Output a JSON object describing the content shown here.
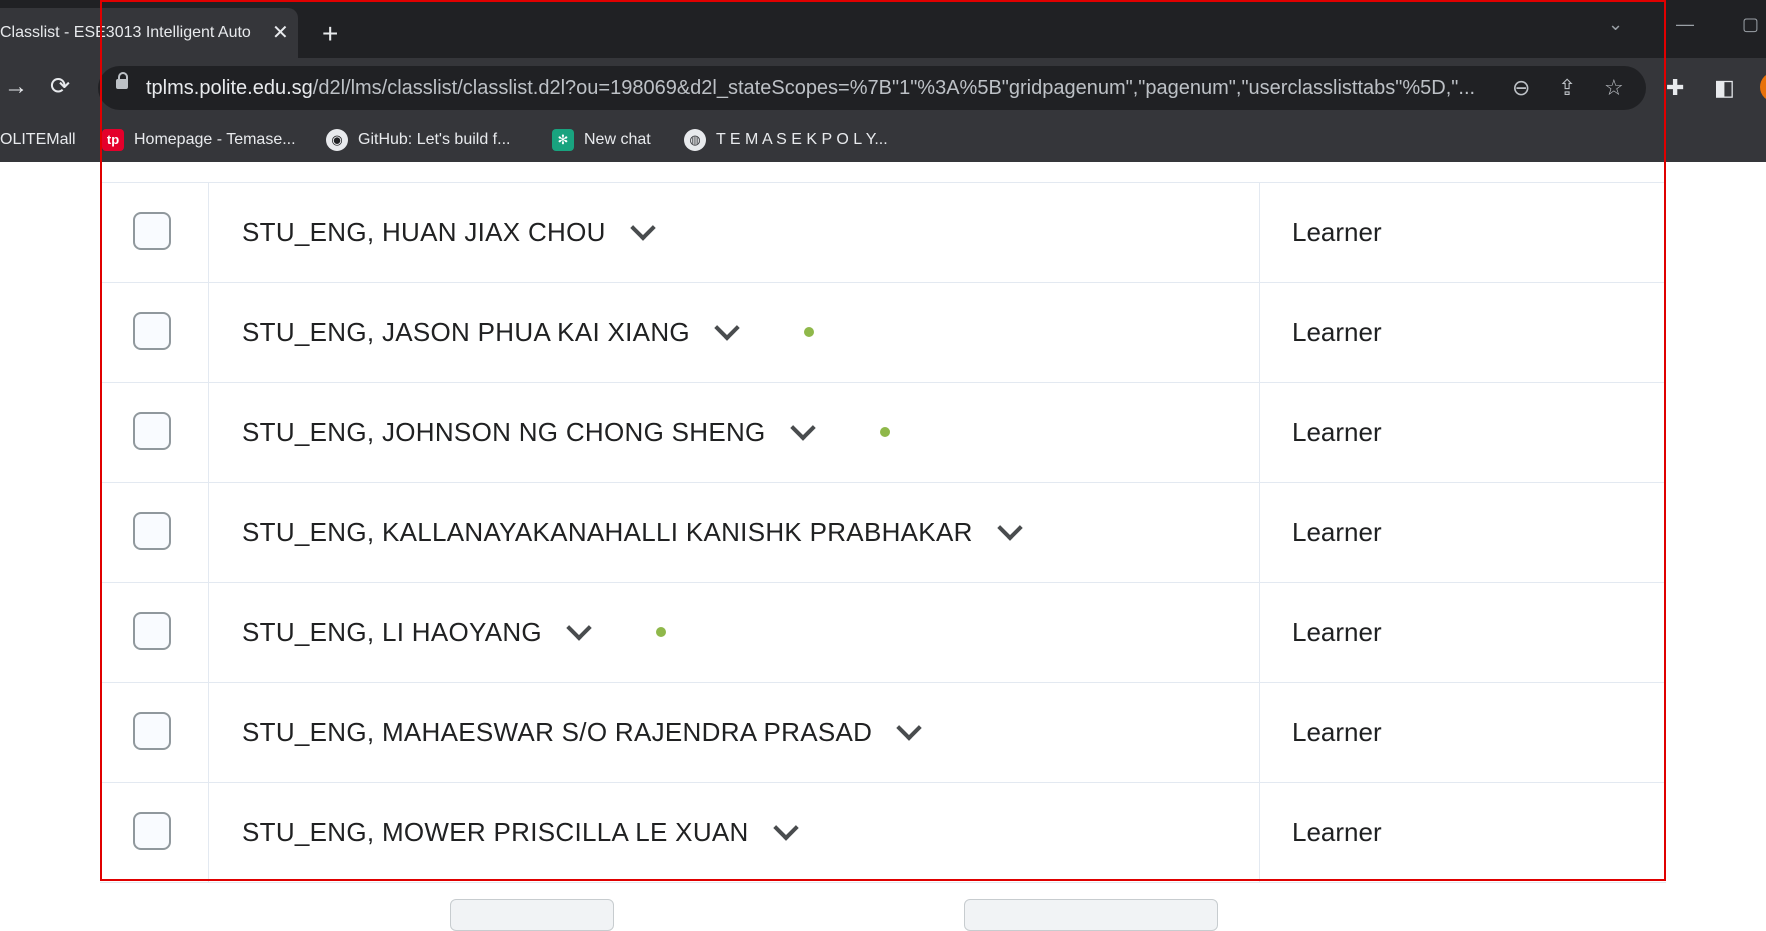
{
  "browser": {
    "tab_title": "Classlist - ESE3013 Intelligent Auto",
    "tab_close": "✕",
    "new_tab": "+",
    "url_host": "tplms.polite.edu.sg",
    "url_path": "/d2l/lms/classlist/classlist.d2l?ou=198069&d2l_stateScopes=%7B\"1\"%3A%5B\"gridpagenum\",\"pagenum\",\"userclasslisttabs\"%5D,\"..."
  },
  "bookmarks": [
    {
      "label": "OLITEMall"
    },
    {
      "label": "Homepage - Temase...",
      "icon": "tp"
    },
    {
      "label": "GitHub: Let's build f...",
      "icon": "github"
    },
    {
      "label": "New chat",
      "icon": "chatgpt"
    },
    {
      "label": "T E M A S E K P O L Y...",
      "icon": "globe"
    }
  ],
  "classlist": {
    "rows": [
      {
        "name": "STU_ENG, HUAN JIAX CHOU",
        "role": "Learner",
        "online": false
      },
      {
        "name": "STU_ENG, JASON PHUA KAI XIANG",
        "role": "Learner",
        "online": true
      },
      {
        "name": "STU_ENG, JOHNSON NG CHONG SHENG",
        "role": "Learner",
        "online": true
      },
      {
        "name": "STU_ENG, KALLANAYAKANAHALLI KANISHK PRABHAKAR",
        "role": "Learner",
        "online": false
      },
      {
        "name": "STU_ENG, LI HAOYANG",
        "role": "Learner",
        "online": true
      },
      {
        "name": "STU_ENG, MAHAESWAR S/O RAJENDRA PRASAD",
        "role": "Learner",
        "online": false
      },
      {
        "name": "STU_ENG, MOWER PRISCILLA LE XUAN",
        "role": "Learner",
        "online": false
      }
    ]
  },
  "colors": {
    "annotation_box": "#e00000",
    "online_dot": "#8fb84a"
  }
}
